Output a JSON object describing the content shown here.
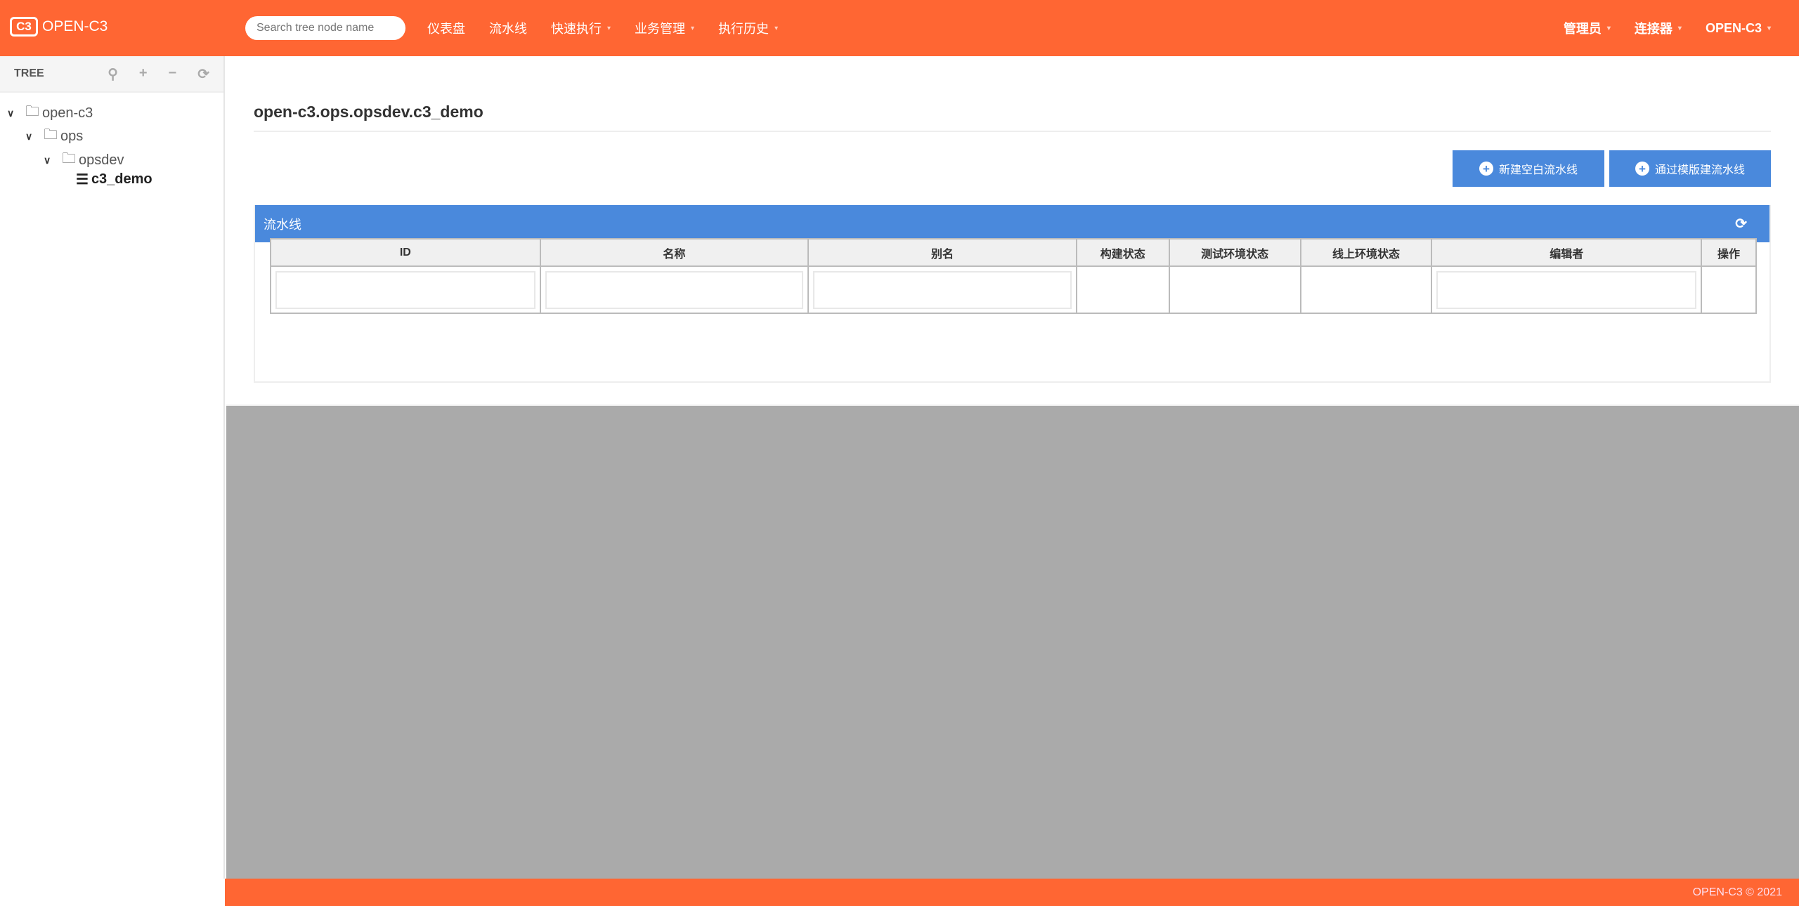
{
  "header": {
    "logo": "OPEN-C3",
    "logo_mark": "C3",
    "search_placeholder": "Search tree node name",
    "nav": [
      {
        "label": "仪表盘",
        "dropdown": false
      },
      {
        "label": "流水线",
        "dropdown": false
      },
      {
        "label": "快速执行",
        "dropdown": true
      },
      {
        "label": "业务管理",
        "dropdown": true
      },
      {
        "label": "执行历史",
        "dropdown": true
      }
    ],
    "right_nav": [
      {
        "label": "管理员"
      },
      {
        "label": "连接器"
      },
      {
        "label": "OPEN-C3"
      }
    ],
    "caret": "▾"
  },
  "sidebar": {
    "title": "TREE",
    "tools": {
      "locate": "⚲",
      "add": "+",
      "remove": "−",
      "refresh": "⟳"
    },
    "nodes": [
      {
        "label": "open-c3"
      },
      {
        "label": "ops"
      },
      {
        "label": "opsdev"
      },
      {
        "label": "c3_demo"
      }
    ]
  },
  "main": {
    "title": "open-c3.ops.opsdev.c3_demo",
    "buttons": {
      "new_blank": "新建空白流水线",
      "from_template": "通过模版建流水线"
    },
    "panel": {
      "title": "流水线",
      "refresh": "⟳"
    },
    "table": {
      "columns": [
        "ID",
        "名称",
        "别名",
        "构建状态",
        "测试环境状态",
        "线上环境状态",
        "编辑者",
        "操作"
      ]
    }
  },
  "footer": {
    "text": "OPEN-C3 © 2021"
  },
  "colors": {
    "brand": "#ff6633",
    "primary": "#4a89dc"
  }
}
